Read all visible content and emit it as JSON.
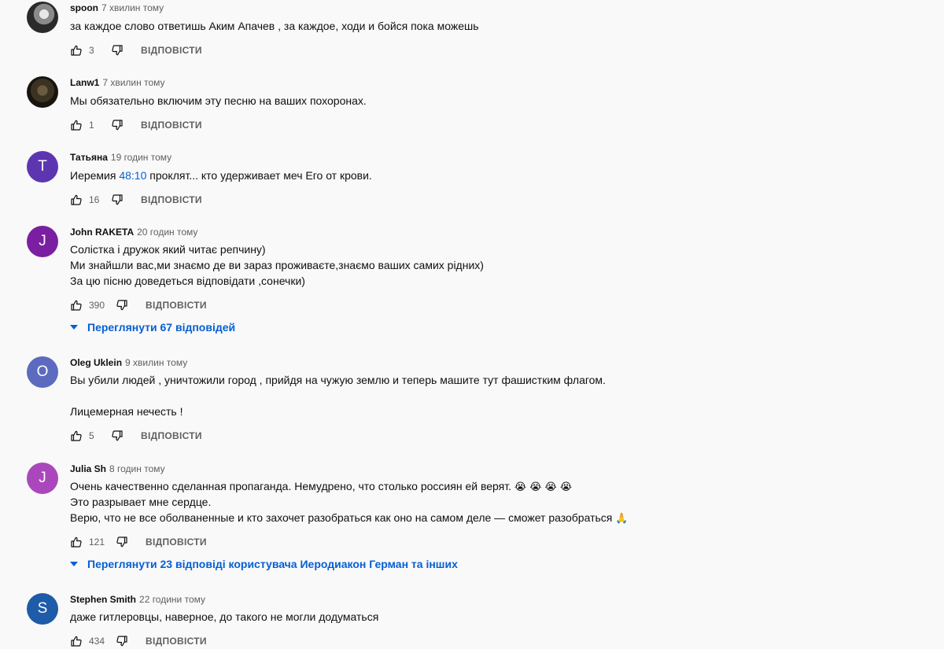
{
  "reply_label": "ВІДПОВІСТИ",
  "colors": {
    "link": "#065fd4",
    "meta": "#606060",
    "text": "#0f0f0f"
  },
  "comments": [
    {
      "author": "spoon",
      "time": "7 хвилин тому",
      "avatar": "photo",
      "lines": [
        "за каждое слово ответишь Аким Апачев , за каждое, ходи и бойся пока можешь"
      ],
      "likes": "3"
    },
    {
      "author": "Lanw1",
      "time": "7 хвилин тому",
      "avatar": "photo",
      "lines": [
        "Мы обязательно включим эту песню на ваших похоронах."
      ],
      "likes": "1"
    },
    {
      "author": "Татьяна",
      "time": "19 годин тому",
      "avatar_letter": "Т",
      "avatar_color": "#5e35b1",
      "text_before": "Иеремия ",
      "timestamp_link": "48:10",
      "text_after": " проклят... кто удерживает меч Его от крови.",
      "likes": "16"
    },
    {
      "author": "John RAKETA",
      "time": "20 годин тому",
      "avatar_letter": "J",
      "avatar_color": "#7b1fa2",
      "lines": [
        "Солістка і дружок який читає репчину)",
        "Ми знайшли вас,ми знаємо де ви зараз проживаєте,знаємо ваших самих рідних)",
        "За цю пісню доведеться відповідати ,сонечки)"
      ],
      "likes": "390",
      "replies": "Переглянути 67 відповідей"
    },
    {
      "author": "Oleg Uklein",
      "time": "9 хвилин тому",
      "avatar_letter": "O",
      "avatar_color": "#5c6bc0",
      "lines": [
        "Вы убили людей , уничтожили город , прийдя на чужую землю и теперь машите тут фашистким флагом.",
        "",
        "Лицемерная нечесть !"
      ],
      "likes": "5"
    },
    {
      "author": "Julia Sh",
      "time": "8 годин тому",
      "avatar_letter": "J",
      "avatar_color": "#ab47bc",
      "lines": [
        "Очень качественно сделанная пропаганда. Немудрено, что столько россиян ей верят.",
        "Это разрывает мне сердце.",
        "Верю, что не все оболваненные и кто захочет разобраться как оно на самом деле — сможет разобраться"
      ],
      "emoji_line1": "😭 😭 😭 😭",
      "emoji_line3": "🙏",
      "likes": "121",
      "replies": "Переглянути 23 відповіді користувача Иеродиакон Герман та інших"
    },
    {
      "author": "Stephen Smith",
      "time": "22 години тому",
      "avatar_letter": "S",
      "avatar_color": "#1e5ba8",
      "lines": [
        "даже гитлеровцы, наверное, до такого не могли додуматься"
      ],
      "likes": "434"
    }
  ]
}
